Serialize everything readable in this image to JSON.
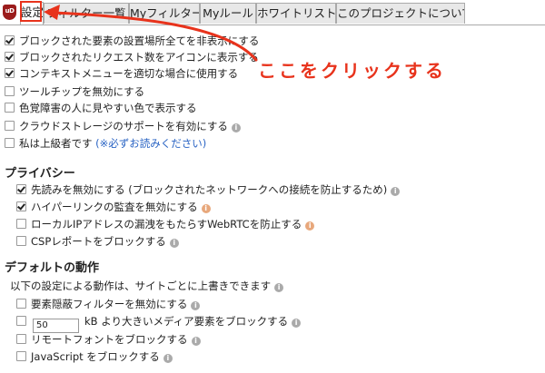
{
  "tabs": [
    {
      "label": "設定",
      "active": true
    },
    {
      "label": "フィルター一覧",
      "active": false
    },
    {
      "label": "Myフィルター",
      "active": false
    },
    {
      "label": "Myルール",
      "active": false
    },
    {
      "label": "ホワイトリスト",
      "active": false
    },
    {
      "label": "このプロジェクトについて",
      "active": false
    }
  ],
  "logo_text": "uD",
  "general": [
    {
      "label": "ブロックされた要素の設置場所全てを非表示にする",
      "checked": true
    },
    {
      "label": "ブロックされたリクエスト数をアイコンに表示する",
      "checked": true
    },
    {
      "label": "コンテキストメニューを適切な場合に使用する",
      "checked": true
    },
    {
      "label": "ツールチップを無効にする",
      "checked": false
    },
    {
      "label": "色覚障害の人に見やすい色で表示する",
      "checked": false
    },
    {
      "label": "クラウドストレージのサポートを有効にする",
      "checked": false
    },
    {
      "label": "私は上級者です",
      "checked": false,
      "link": "(※必ずお読みください)"
    }
  ],
  "privacy": {
    "heading": "プライバシー",
    "items": [
      {
        "label": "先読みを無効にする (ブロックされたネットワークへの接続を防止するため)",
        "checked": true
      },
      {
        "label": "ハイパーリンクの監査を無効にする",
        "checked": true
      },
      {
        "label": "ローカルIPアドレスの漏洩をもたらすWebRTCを防止する",
        "checked": false
      },
      {
        "label": "CSPレポートをブロックする",
        "checked": false
      }
    ]
  },
  "defaults": {
    "heading": "デフォルトの動作",
    "note": "以下の設定による動作は、サイトごとに上書きできます",
    "items": [
      {
        "label": "要素隠蔽フィルターを無効にする",
        "checked": false
      },
      {
        "label": "kB より大きいメディア要素をブロックする",
        "checked": false,
        "input_value": "50"
      },
      {
        "label": "リモートフォントをブロックする",
        "checked": false
      },
      {
        "label": "JavaScript をブロックする",
        "checked": false
      }
    ]
  },
  "annotation": {
    "text": "ここをクリックする",
    "color": "#e8331c"
  },
  "info_icon_glyph": "i"
}
